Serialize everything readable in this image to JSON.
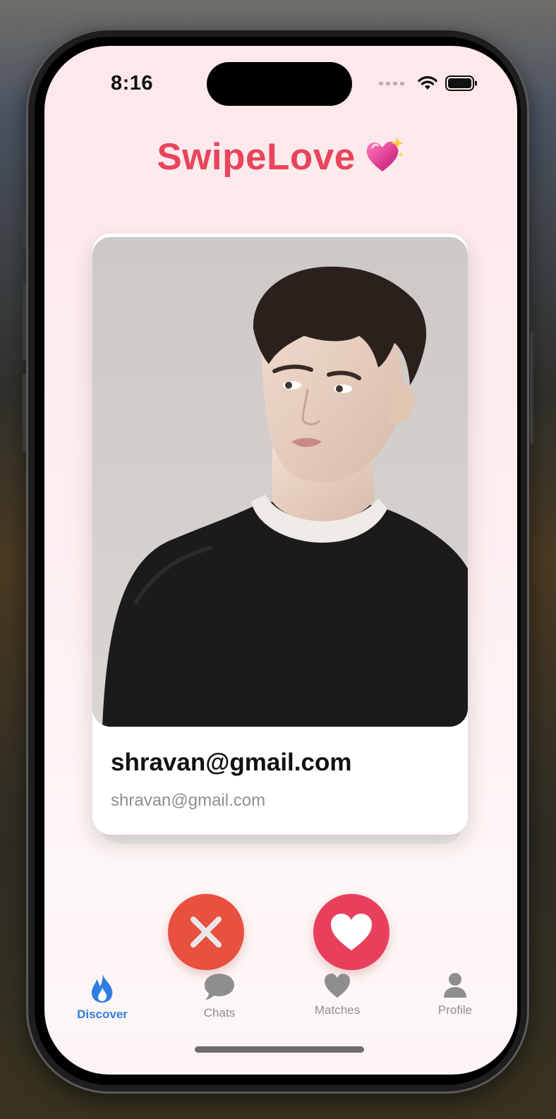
{
  "status_bar": {
    "time": "8:16"
  },
  "header": {
    "title": "SwipeLove",
    "emoji": "💖"
  },
  "card": {
    "name": "shravan@gmail.com",
    "email": "shravan@gmail.com"
  },
  "tabs": [
    {
      "label": "Discover",
      "icon": "flame-icon",
      "active": true
    },
    {
      "label": "Chats",
      "icon": "chat-bubble-icon",
      "active": false
    },
    {
      "label": "Matches",
      "icon": "heart-icon",
      "active": false
    },
    {
      "label": "Profile",
      "icon": "person-icon",
      "active": false
    }
  ],
  "colors": {
    "brand": "#e8455c",
    "nope": "#e8503f",
    "like": "#e8405c",
    "active_tab": "#2f7de1",
    "inactive_tab": "#8e8e8e"
  }
}
